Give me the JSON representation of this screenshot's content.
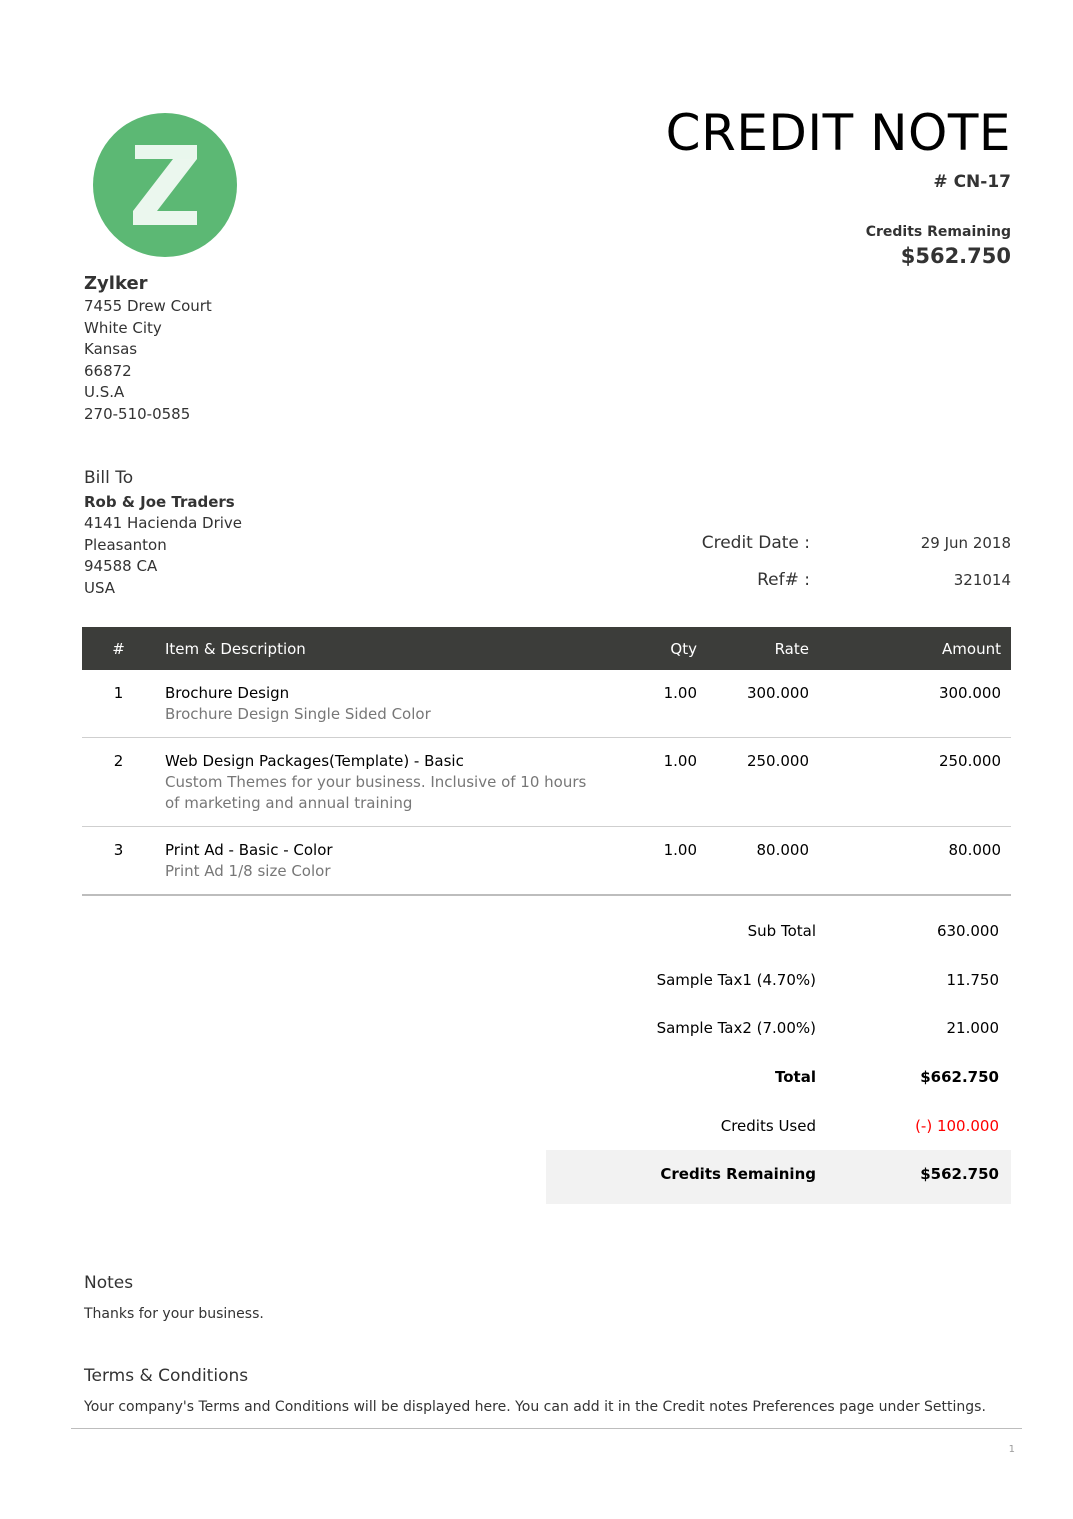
{
  "document": {
    "title": "CREDIT NOTE",
    "number": "# CN-17",
    "credits_remaining_label": "Credits Remaining",
    "credits_remaining_amount": "$562.750"
  },
  "company": {
    "logo_icon": "zylker-z-logo-icon",
    "logo_color": "#5cb874",
    "name": "Zylker",
    "address": [
      "7455 Drew Court",
      "White City",
      "Kansas",
      "66872",
      "U.S.A",
      "270-510-0585"
    ]
  },
  "bill_to": {
    "label": "Bill To",
    "name": "Rob & Joe Traders",
    "address": [
      "4141 Hacienda Drive",
      "Pleasanton",
      "94588 CA",
      "USA"
    ]
  },
  "meta": {
    "credit_date_label": "Credit Date :",
    "credit_date_value": "29 Jun 2018",
    "ref_label": "Ref# :",
    "ref_value": "321014"
  },
  "table": {
    "header_bg": "#3c3d3a",
    "headers": {
      "num": "#",
      "item": "Item & Description",
      "qty": "Qty",
      "rate": "Rate",
      "amount": "Amount"
    },
    "rows": [
      {
        "num": "1",
        "item": "Brochure Design",
        "desc": "Brochure Design Single Sided Color",
        "qty": "1.00",
        "rate": "300.000",
        "amount": "300.000"
      },
      {
        "num": "2",
        "item": "Web Design Packages(Template) - Basic",
        "desc": "Custom Themes for your business. Inclusive of 10 hours of marketing and annual training",
        "qty": "1.00",
        "rate": "250.000",
        "amount": "250.000"
      },
      {
        "num": "3",
        "item": "Print Ad - Basic - Color",
        "desc": "Print Ad 1/8 size Color",
        "qty": "1.00",
        "rate": "80.000",
        "amount": "80.000"
      }
    ]
  },
  "totals": {
    "sub_total_label": "Sub Total",
    "sub_total": "630.000",
    "tax1_label": "Sample Tax1 (4.70%)",
    "tax1": "11.750",
    "tax2_label": "Sample Tax2 (7.00%)",
    "tax2": "21.000",
    "total_label": "Total",
    "total": "$662.750",
    "credits_used_label": "Credits Used",
    "credits_used": "(-) 100.000",
    "credits_remaining_label": "Credits Remaining",
    "credits_remaining": "$562.750"
  },
  "notes": {
    "title": "Notes",
    "text": "Thanks for your business."
  },
  "terms": {
    "title": "Terms & Conditions",
    "text": "Your company's Terms and Conditions will be displayed here. You can add it in the Credit notes Preferences page under Settings."
  },
  "page_number": "1"
}
